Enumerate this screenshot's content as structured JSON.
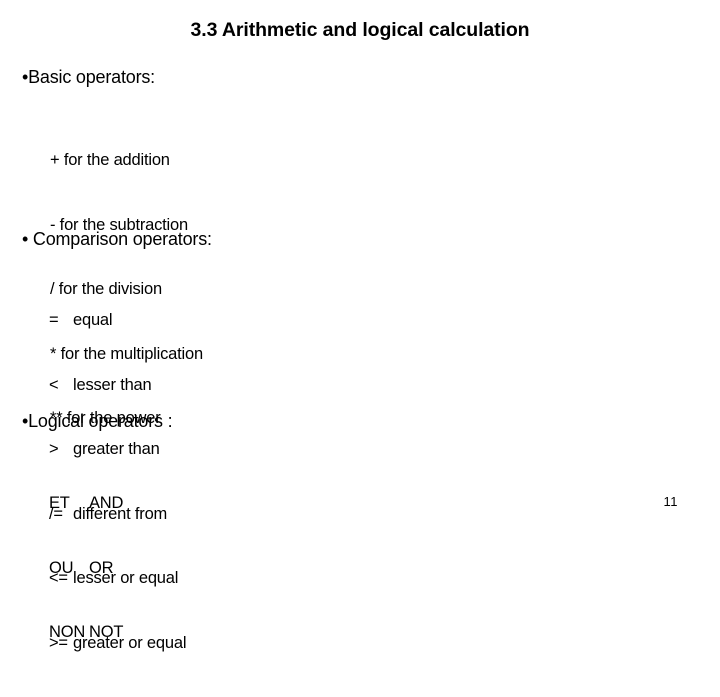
{
  "slide": {
    "title": "3.3 Arithmetic and logical calculation",
    "page_number": "11",
    "bullet_glyph_tight": "•",
    "bullet_glyph_spaced": "• ",
    "sections": {
      "basic": {
        "heading": "Basic operators:",
        "items": [
          "+ for the addition",
          "- for the subtraction",
          "/ for the division",
          "* for the multiplication",
          "** for the power"
        ]
      },
      "comparison": {
        "heading": "Comparison operators:",
        "items": [
          {
            "symbol": "=",
            "label": "equal"
          },
          {
            "symbol": "<",
            "label": "lesser than"
          },
          {
            "symbol": ">",
            "label": "greater than"
          },
          {
            "symbol": "/=",
            "label": "different from"
          },
          {
            "symbol": "<=",
            "label": "lesser or equal"
          },
          {
            "symbol": ">=",
            "label": "greater or equal"
          }
        ]
      },
      "logical": {
        "heading": "Logical operators :",
        "items": [
          {
            "fr": "ET",
            "en": "AND"
          },
          {
            "fr": "OU",
            "en": "OR"
          },
          {
            "fr": "NON",
            "en": "NOT"
          }
        ]
      }
    }
  }
}
